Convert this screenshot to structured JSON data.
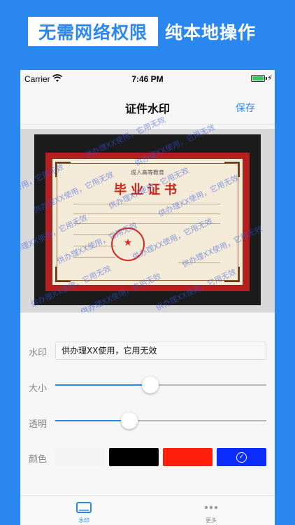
{
  "banner": {
    "highlight": "无需网络权限",
    "text": "纯本地操作"
  },
  "status_bar": {
    "carrier": "Carrier",
    "time": "7:46 PM"
  },
  "nav": {
    "title": "证件水印",
    "save_label": "保存"
  },
  "preview": {
    "watermark_text": "供办理XX使用，它用无效",
    "certificate": {
      "school_line": "成人高等教育",
      "title": "毕业证书"
    }
  },
  "controls": {
    "watermark_label": "水印",
    "watermark_value": "供办理XX使用，它用无效",
    "size_label": "大小",
    "size_value": 0.45,
    "opacity_label": "透明",
    "opacity_value": 0.35,
    "color_label": "颜色",
    "colors": [
      {
        "name": "white",
        "hex": "#f4f4f4",
        "selected": false
      },
      {
        "name": "black",
        "hex": "#000000",
        "selected": false
      },
      {
        "name": "red",
        "hex": "#ff1e0b",
        "selected": false
      },
      {
        "name": "blue",
        "hex": "#0b2cff",
        "selected": true
      }
    ]
  },
  "tabs": [
    {
      "label": "水印",
      "icon": "rectangle-icon",
      "active": true
    },
    {
      "label": "更多",
      "icon": "ellipsis-icon",
      "active": false
    }
  ],
  "theme": {
    "accent": "#2b87f0"
  }
}
